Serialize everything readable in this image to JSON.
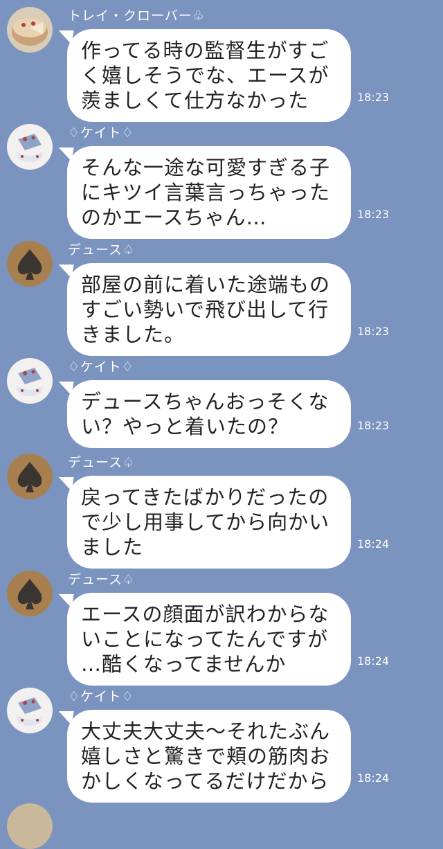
{
  "messages": [
    {
      "sender": "トレイ・クローバー♧",
      "avatar": "cake-avatar-icon",
      "text": "作ってる時の監督生がすご\nく嬉しそうでな、エースが\n羨ましくて仕方なかった",
      "time": "18:23"
    },
    {
      "sender": "♢ケイト♢",
      "avatar": "teacup-avatar-icon",
      "text": "そんな一途な可愛すぎる子\nにキツイ言葉言っちゃった\nのかエースちゃん…",
      "time": "18:23"
    },
    {
      "sender": "デュース♤",
      "avatar": "spade-avatar-icon",
      "text": "部屋の前に着いた途端もの\nすごい勢いで飛び出して行\nきました。",
      "time": "18:23"
    },
    {
      "sender": "♢ケイト♢",
      "avatar": "teacup-avatar-icon",
      "text": "デュースちゃんおっそくな\nい？やっと着いたの？",
      "time": "18:23"
    },
    {
      "sender": "デュース♤",
      "avatar": "spade-avatar-icon",
      "text": "戻ってきたばかりだったの\nで少し用事してから向かい\nました",
      "time": "18:24"
    },
    {
      "sender": "デュース♤",
      "avatar": "spade-avatar-icon",
      "text": "エースの顔面が訳わからな\nいことになってたんですが\n…酷くなってませんか",
      "time": "18:24"
    },
    {
      "sender": "♢ケイト♢",
      "avatar": "teacup-avatar-icon",
      "text": "大丈夫大丈夫〜それたぶん\n嬉しさと驚きで頬の筋肉お\nかしくなってるだけだから",
      "time": "18:24"
    }
  ]
}
